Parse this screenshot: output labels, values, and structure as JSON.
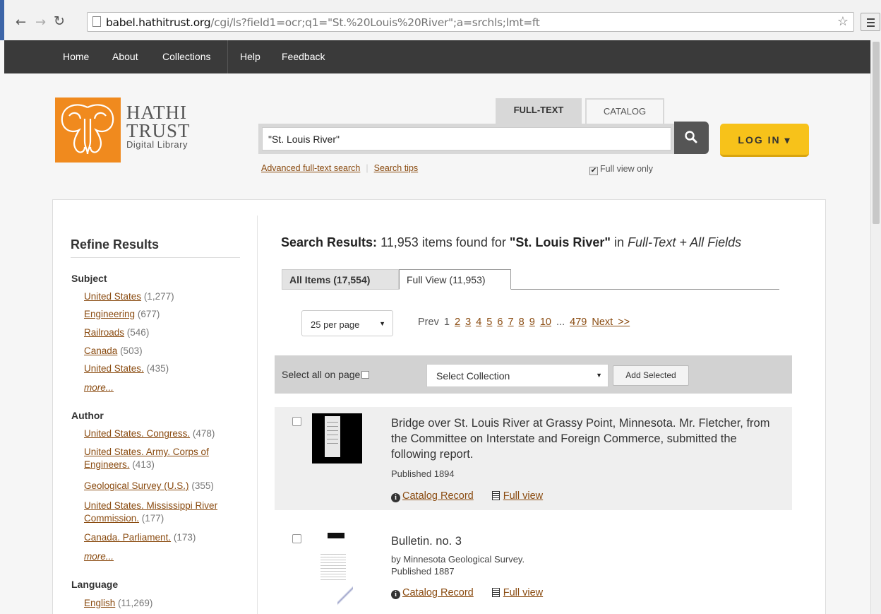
{
  "browser": {
    "url_host": "babel.hathitrust.org",
    "url_path": "/cgi/ls?field1=ocr;q1=\"St.%20Louis%20River\";a=srchls;lmt=ft"
  },
  "topnav": {
    "items": [
      "Home",
      "About",
      "Collections",
      "Help",
      "Feedback"
    ]
  },
  "logo": {
    "line1": "HATHI",
    "line2": "TRUST",
    "line3": "Digital Library"
  },
  "search": {
    "tabs": [
      "FULL-TEXT",
      "CATALOG"
    ],
    "query": "\"St. Louis River\"",
    "advanced_link": "Advanced full-text search",
    "tips_link": "Search tips",
    "full_view_only": "Full view only"
  },
  "login": {
    "label": "LOG IN ▾"
  },
  "sidebar": {
    "title": "Refine Results",
    "facets": [
      {
        "name": "Subject",
        "items": [
          {
            "label": "United States",
            "count": "(1,277)"
          },
          {
            "label": "Engineering",
            "count": "(677)"
          },
          {
            "label": "Railroads",
            "count": "(546)"
          },
          {
            "label": "Canada",
            "count": "(503)"
          },
          {
            "label": "United States.",
            "count": "(435)"
          }
        ],
        "more": "more..."
      },
      {
        "name": "Author",
        "items": [
          {
            "label": "United States. Congress.",
            "count": "(478)"
          },
          {
            "label": "United States. Army. Corps of Engineers.",
            "count": "(413)"
          },
          {
            "label": "Geological Survey (U.S.)",
            "count": "(355)"
          },
          {
            "label": "United States. Mississippi River Commission.",
            "count": "(177)"
          },
          {
            "label": "Canada. Parliament.",
            "count": "(173)"
          }
        ],
        "more": "more..."
      },
      {
        "name": "Language",
        "items": [
          {
            "label": "English",
            "count": "(11,269)"
          }
        ]
      }
    ]
  },
  "results": {
    "heading_label": "Search Results:",
    "heading_count": " 11,953 items found for ",
    "heading_query": "\"St. Louis River\"",
    "heading_in": " in ",
    "heading_scope": "Full-Text + All Fields",
    "tab_all": "All Items (17,554)",
    "tab_full": "Full View (11,953)",
    "per_page": "25 per page",
    "pager": {
      "prev": "Prev",
      "current": "1",
      "pages": [
        "2",
        "3",
        "4",
        "5",
        "6",
        "7",
        "8",
        "9",
        "10"
      ],
      "ellipsis": "...",
      "last": "479",
      "next": "Next >>"
    },
    "select_all": "Select all on page",
    "select_collection": "Select Collection",
    "add_selected": "Add Selected",
    "items": [
      {
        "title": "Bridge over St. Louis River at Grassy Point, Minnesota. Mr. Fletcher, from the Committee on Interstate and Foreign Commerce, submitted the following report.",
        "author": "",
        "published": "Published 1894",
        "catalog_link": "Catalog Record",
        "full_view_link": "Full view"
      },
      {
        "title": "Bulletin. no. 3",
        "author": "by Minnesota Geological Survey.",
        "published": "Published 1887",
        "catalog_link": "Catalog Record",
        "full_view_link": "Full view"
      }
    ]
  },
  "colors": {
    "accent_orange": "#f08a1e",
    "login_yellow": "#f7c21a",
    "link_brown": "#8a4b10",
    "nav_dark": "#3a3a3a"
  }
}
